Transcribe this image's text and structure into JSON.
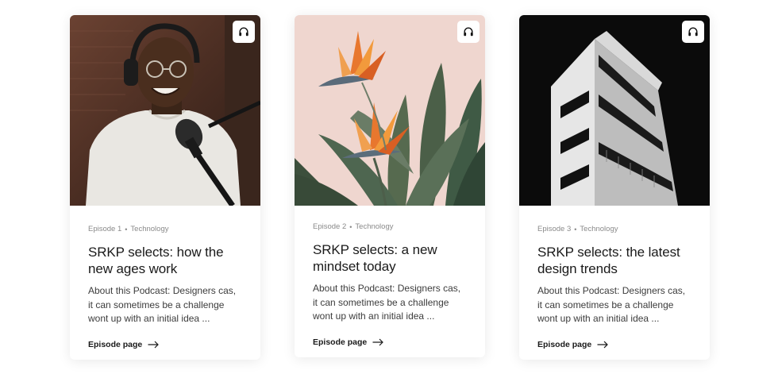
{
  "cards": [
    {
      "episode": "Episode 1",
      "category": "Technology",
      "title": "SRKP selects: how the new ages work",
      "description": "About this Podcast: Designers cas, it can sometimes be a challenge wont up with an initial idea ...",
      "link_label": "Episode page",
      "image": "man-with-headphones-at-microphone",
      "icon": "headphones-icon"
    },
    {
      "episode": "Episode 2",
      "category": "Technology",
      "title": "SRKP selects: a new mindset today",
      "description": "About this Podcast: Designers cas, it can sometimes be a challenge wont up with an initial idea ...",
      "link_label": "Episode page",
      "image": "bird-of-paradise-flowers",
      "icon": "headphones-icon"
    },
    {
      "episode": "Episode 3",
      "category": "Technology",
      "title": "SRKP selects: the latest design trends",
      "description": "About this Podcast: Designers cas, it can sometimes be a challenge wont up with an initial idea ...",
      "link_label": "Episode page",
      "image": "modern-white-building",
      "icon": "headphones-icon"
    }
  ],
  "meta_separator": "•",
  "colors": {
    "card_background": "#ffffff",
    "title": "#1a1a1a",
    "meta": "#8a8a8a",
    "description": "#3c3c3c"
  }
}
